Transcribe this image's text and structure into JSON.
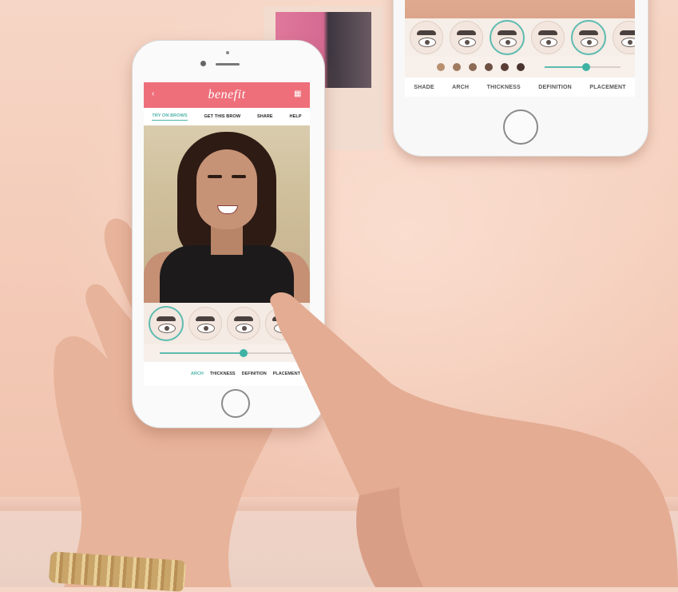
{
  "top_phone": {
    "tabs": [
      "SHADE",
      "ARCH",
      "THICKNESS",
      "DEFINITION",
      "PLACEMENT"
    ],
    "brow_options_count": 6,
    "shade_swatches": [
      "#b8906f",
      "#a07a60",
      "#8c6a55",
      "#6e4f44",
      "#5a3e36",
      "#4a342e"
    ],
    "slider_value": 0.55
  },
  "main_phone": {
    "brand_logo": "benefit",
    "nav_tabs": [
      "TRY ON BROWS",
      "GET THIS BROW",
      "SHARE",
      "HELP"
    ],
    "active_nav": "TRY ON BROWS",
    "tabs": [
      "ARCH",
      "THICKNESS",
      "DEFINITION",
      "PLACEMENT"
    ],
    "active_tab": "ARCH",
    "slider_value": 0.62
  },
  "colors": {
    "header_pink": "#ee6f7a",
    "accent_teal": "#4fb3a8"
  },
  "icons": {
    "header_left": "back-arrow-icon",
    "header_right": "menu-icon"
  }
}
